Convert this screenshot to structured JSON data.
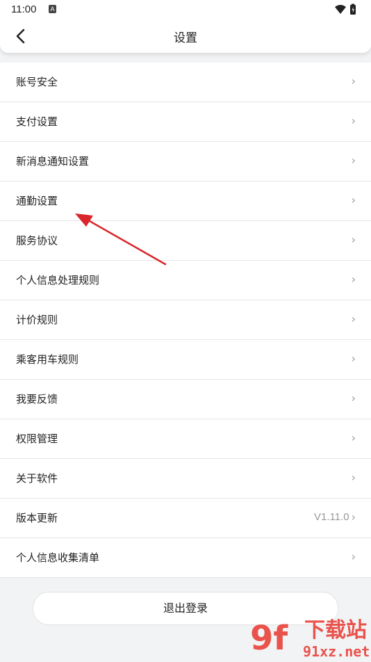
{
  "status_bar": {
    "time": "11:00",
    "notif_glyph": "A",
    "icons": [
      "wifi-icon",
      "battery-icon"
    ]
  },
  "header": {
    "title": "设置",
    "back_icon": "chevron-left-icon"
  },
  "settings": [
    {
      "label": "账号安全"
    },
    {
      "label": "支付设置"
    },
    {
      "label": "新消息通知设置"
    },
    {
      "label": "通勤设置"
    },
    {
      "label": "服务协议"
    },
    {
      "label": "个人信息处理规则"
    },
    {
      "label": "计价规则"
    },
    {
      "label": "乘客用车规则"
    },
    {
      "label": "我要反馈"
    },
    {
      "label": "权限管理"
    },
    {
      "label": "关于软件"
    },
    {
      "label": "版本更新",
      "value": "V1.11.0"
    },
    {
      "label": "个人信息收集清单"
    }
  ],
  "chevron": "›",
  "logout": {
    "label": "退出登录"
  },
  "watermark": {
    "logo_text": "9f",
    "text_cn": "下载站",
    "text_en": "91xz.net"
  },
  "colors": {
    "annotation_arrow": "#d9262b",
    "watermark": "#e8362e"
  }
}
